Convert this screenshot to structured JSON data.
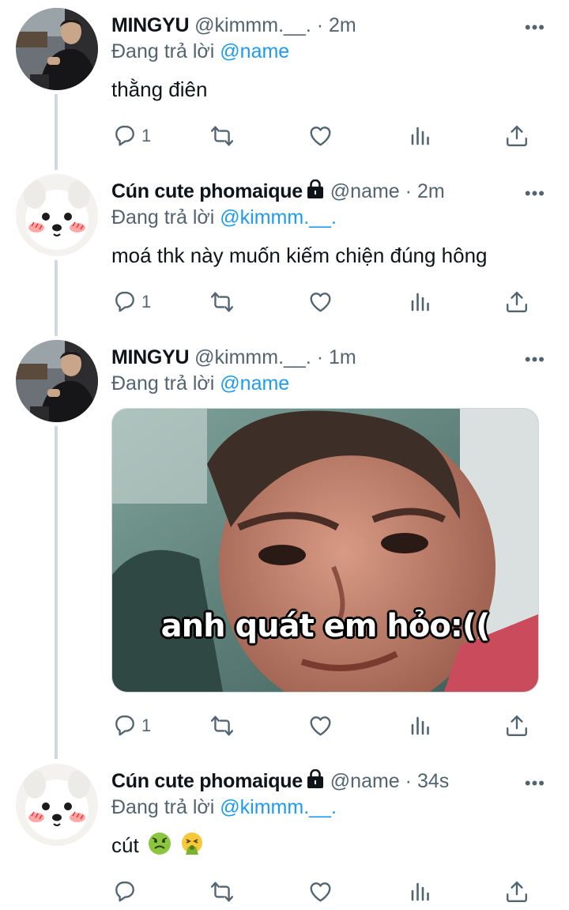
{
  "tweets": [
    {
      "author": "MINGYU",
      "handle": "@kimmm.__.",
      "sep": "·",
      "time": "2m",
      "reply_prefix": "Đang trả lời ",
      "reply_to": "@name",
      "text": "thằng điên",
      "reply_count": "1",
      "locked": false,
      "avatar": "man-photo"
    },
    {
      "author": "Cún cute phomaique",
      "handle": "@name",
      "sep": "·",
      "time": "2m",
      "reply_prefix": "Đang trả lời ",
      "reply_to": "@kimmm.__.",
      "text": "moá thk này muốn kiếm chiện đúng hông",
      "reply_count": "1",
      "locked": true,
      "avatar": "white-dog-photo"
    },
    {
      "author": "MINGYU",
      "handle": "@kimmm.__.",
      "sep": "·",
      "time": "1m",
      "reply_prefix": "Đang trả lời ",
      "reply_to": "@name",
      "media_caption": "anh quát em hỏo:((",
      "reply_count": "1",
      "locked": false,
      "avatar": "man-photo"
    },
    {
      "author": "Cún cute phomaique",
      "handle": "@name",
      "sep": "·",
      "time": "34s",
      "reply_prefix": "Đang trả lời ",
      "reply_to": "@kimmm.__.",
      "text": "cút",
      "emojis": [
        "nauseated-face",
        "vomiting-face"
      ],
      "reply_count": "",
      "locked": true,
      "avatar": "white-dog-photo"
    }
  ],
  "ui": {
    "more_glyph": "•••",
    "accent": "#1d9bf0",
    "muted": "#536471",
    "icons": [
      "reply-icon",
      "retweet-icon",
      "like-icon",
      "views-icon",
      "share-icon"
    ]
  }
}
